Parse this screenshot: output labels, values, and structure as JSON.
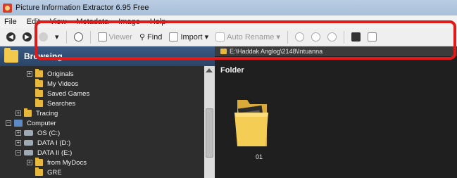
{
  "window": {
    "title": "Picture Information Extractor 6.95 Free"
  },
  "menu": [
    "File",
    "Edit",
    "View",
    "Metadata",
    "Image",
    "Help"
  ],
  "toolbar": {
    "viewer": "Viewer",
    "find": "Find",
    "import": "Import",
    "auto_rename": "Auto Rename"
  },
  "left_pane": {
    "header": "Browsing",
    "tree": [
      {
        "label": "Originals",
        "type": "folder",
        "expandable": true
      },
      {
        "label": "My Videos",
        "type": "folder",
        "expandable": false
      },
      {
        "label": "Saved Games",
        "type": "folder",
        "expandable": false
      },
      {
        "label": "Searches",
        "type": "folder",
        "expandable": false
      },
      {
        "label": "Tracing",
        "type": "folder",
        "expandable": true
      },
      {
        "label": "Computer",
        "type": "computer",
        "expandable": true
      },
      {
        "label": "OS (C:)",
        "type": "drive",
        "expandable": true
      },
      {
        "label": "DATA I (D:)",
        "type": "drive",
        "expandable": true
      },
      {
        "label": "DATA II (E:)",
        "type": "drive",
        "expandable": true
      },
      {
        "label": "from MyDocs",
        "type": "folder",
        "expandable": true
      },
      {
        "label": "GRE",
        "type": "folder",
        "expandable": false
      }
    ]
  },
  "path_bar": {
    "path": "E:\\Haddak Anglog\\2148\\Intuanna"
  },
  "right_pane": {
    "title": "Folder",
    "items": [
      {
        "label": "01"
      }
    ]
  },
  "colors": {
    "highlight": "#e01a1a",
    "folder": "#e8b83d",
    "pane_bg": "#1f1f1f"
  }
}
